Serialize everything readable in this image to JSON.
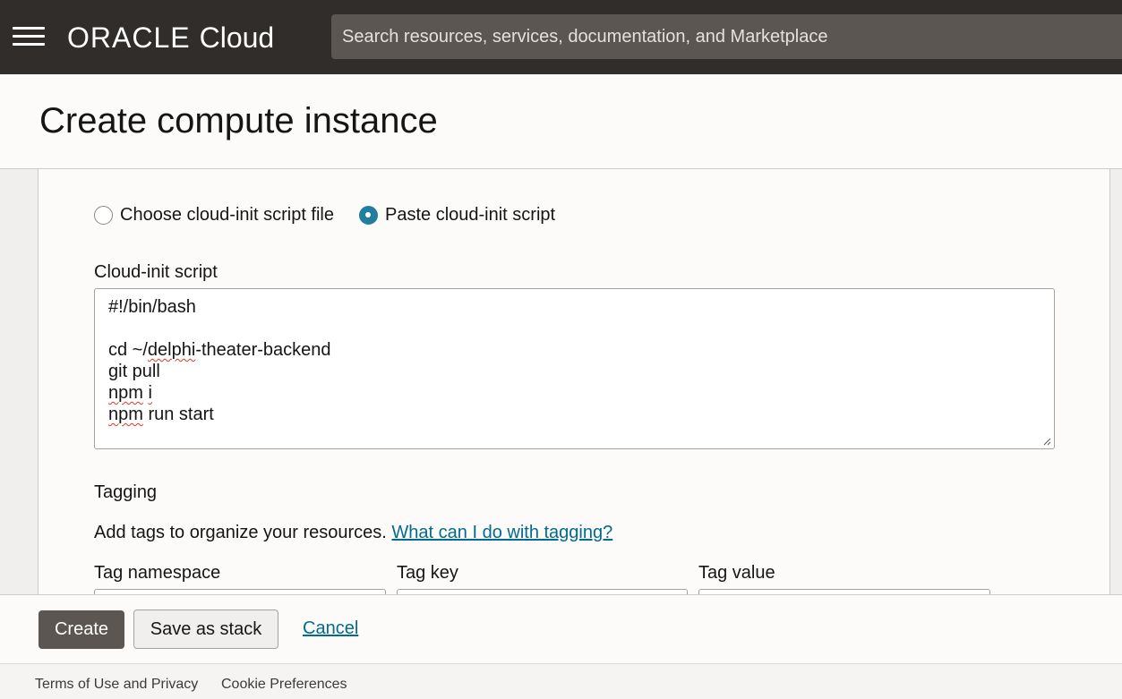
{
  "header": {
    "menu_icon": "hamburger-menu-icon",
    "brand_oracle": "ORACLE",
    "brand_cloud": "Cloud",
    "search_placeholder": "Search resources, services, documentation, and Marketplace"
  },
  "page": {
    "title": "Create compute instance"
  },
  "cloud_init": {
    "option_file": "Choose cloud-init script file",
    "option_paste": "Paste cloud-init script",
    "selected": "paste",
    "script_label": "Cloud-init script",
    "script_lines": [
      "#!/bin/bash",
      "",
      "cd ~/delphi-theater-backend",
      "git pull",
      "npm i",
      "npm run start"
    ]
  },
  "tagging": {
    "title": "Tagging",
    "description": "Add tags to organize your resources.",
    "help_link": "What can I do with tagging?",
    "col_namespace": "Tag namespace",
    "col_key": "Tag key",
    "col_value": "Tag value"
  },
  "actions": {
    "create": "Create",
    "save_stack": "Save as stack",
    "cancel": "Cancel"
  },
  "footer": {
    "terms": "Terms of Use and Privacy",
    "cookies": "Cookie Preferences"
  },
  "colors": {
    "topbar": "#312d2a",
    "search_bg": "#5b5651",
    "accent": "#227e9e",
    "link": "#006b8f",
    "primary_button": "#5b5651"
  }
}
